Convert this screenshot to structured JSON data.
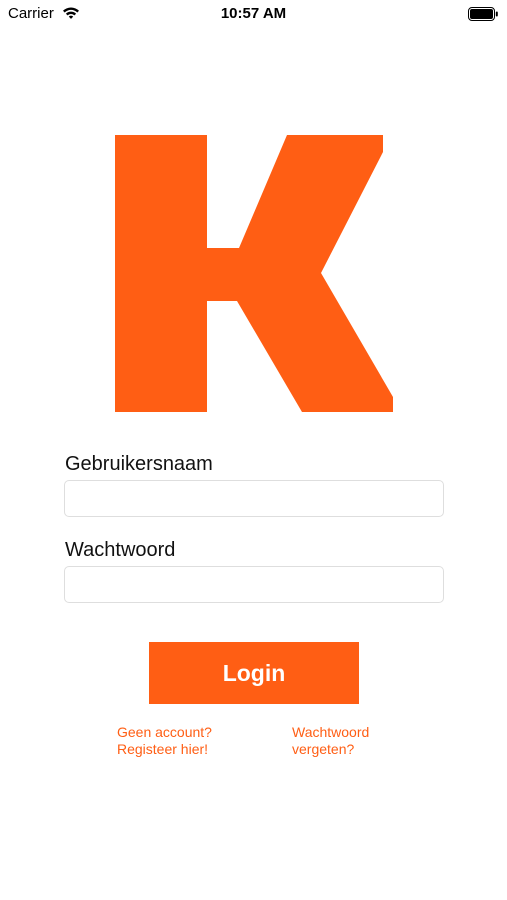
{
  "status_bar": {
    "carrier": "Carrier",
    "time": "10:57 AM",
    "wifi_icon": "wifi-icon",
    "battery_icon": "battery-icon"
  },
  "logo": {
    "icon": "k-logo",
    "color": "#ff5e14"
  },
  "form": {
    "username_label": "Gebruikersnaam",
    "username_value": "",
    "password_label": "Wachtwoord",
    "password_value": "",
    "login_label": "Login"
  },
  "links": {
    "register_line1": "Geen account?",
    "register_line2": "Registeer hier!",
    "forgot_line1": "Wachtwoord",
    "forgot_line2": "vergeten?"
  },
  "colors": {
    "accent": "#ff5e14"
  }
}
